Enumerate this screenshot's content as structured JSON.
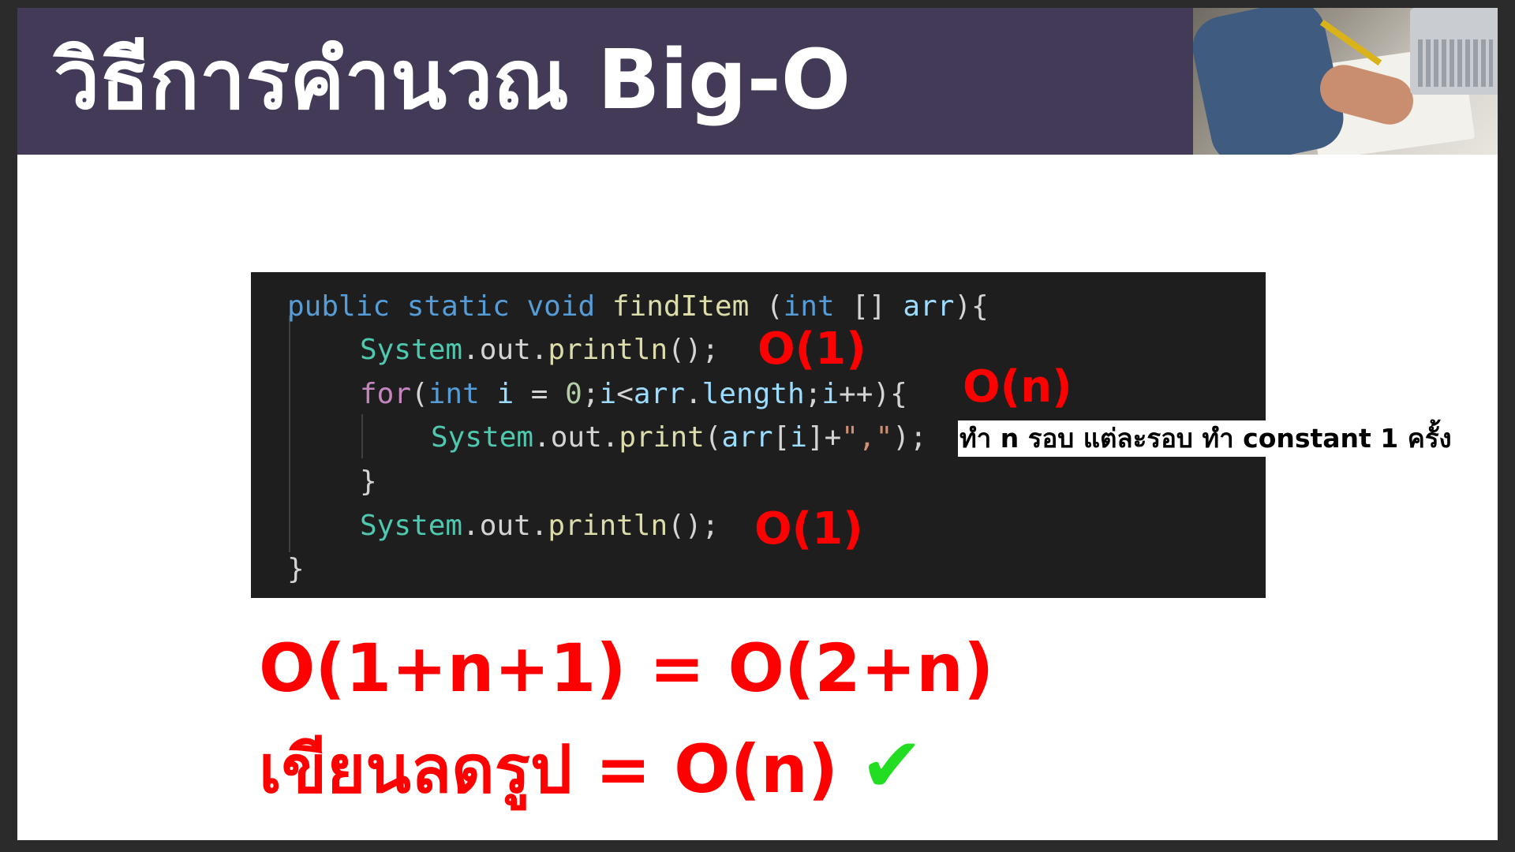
{
  "slide": {
    "title": "วิธีการคำนวณ Big-O"
  },
  "code": {
    "line1": {
      "kw1": "public",
      "kw2": "static",
      "kw3": "void",
      "name": "findItem",
      "open": " (",
      "kw4": "int",
      "rest": " [] ",
      "arr": "arr",
      "close": "){"
    },
    "line2": {
      "cls": "System",
      "rest": ".out.",
      "fn": "println",
      "end": "();"
    },
    "line3": {
      "ctl": "for",
      "p1": "(",
      "kw": "int",
      "v1": "i",
      "eq": " = ",
      "n0": "0",
      "semi": ";",
      "v2": "i",
      "lt": "<",
      "v3": "arr",
      "dot": ".",
      "v4": "length",
      "semi2": ";",
      "v5": "i",
      "tail": "++){"
    },
    "line4": {
      "cls": "System",
      "rest": ".out.",
      "fn": "print",
      "open": "(",
      "arr": "arr",
      "b1": "[",
      "i": "i",
      "b2": "]+",
      "str": "\",\"",
      "end": ");"
    },
    "line5": "}",
    "line6": {
      "cls": "System",
      "rest": ".out.",
      "fn": "println",
      "end": "();"
    },
    "line7": "}"
  },
  "annotations": {
    "o1_first": "O(1)",
    "on_loop": "O(n)",
    "loop_note": "ทำ n รอบ แต่ละรอบ ทำ constant 1 ครั้ง",
    "o1_last": "O(1)"
  },
  "formulas": {
    "line1": "O(1+n+1) = O(2+n)",
    "line2": "เขียนลดรูป = O(n)",
    "check": "✔"
  },
  "colors": {
    "title_bar": "#433a58",
    "code_bg": "#1e1e1e",
    "annotation_red": "#ff0000",
    "check_green": "#22dd22"
  }
}
